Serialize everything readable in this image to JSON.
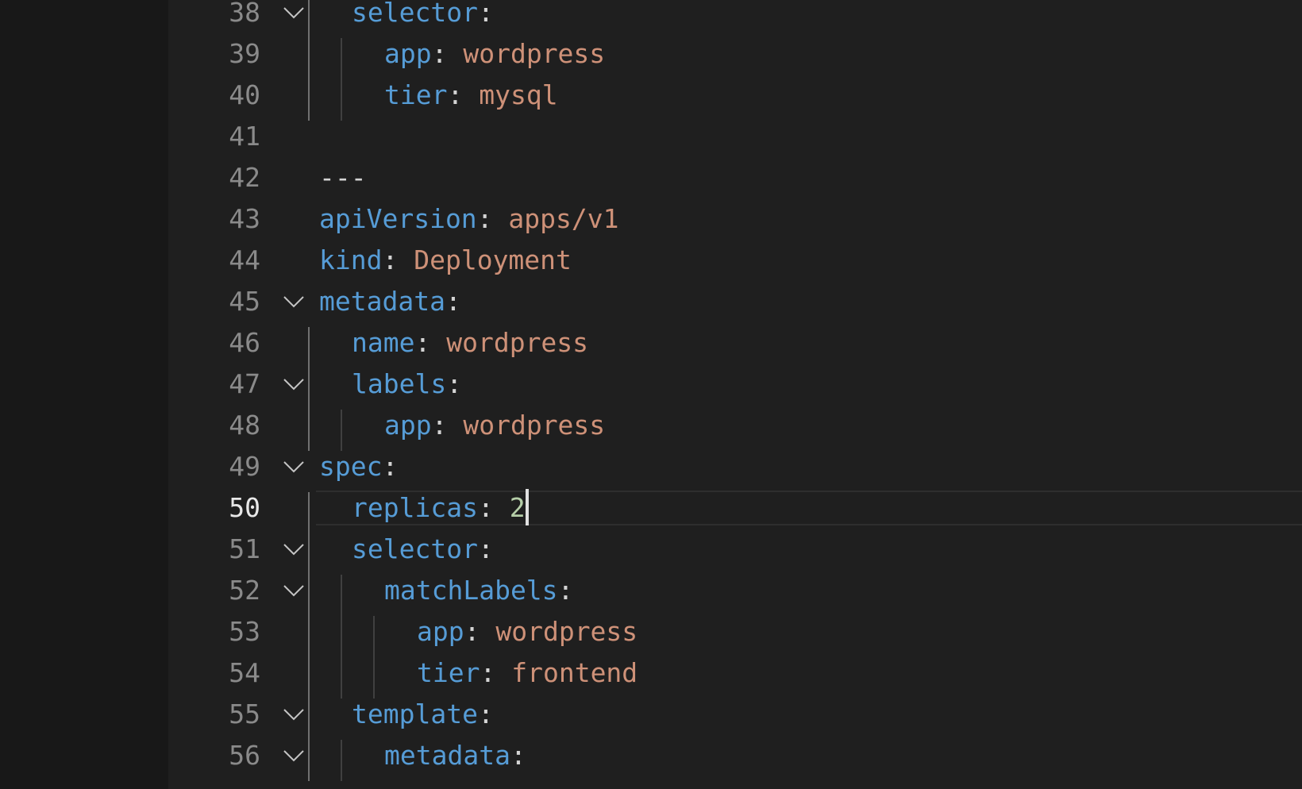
{
  "editor": {
    "lines": [
      {
        "number": "38",
        "indent": 1,
        "fold": true,
        "key": "selector",
        "colon": ":",
        "value": "",
        "vtype": "str"
      },
      {
        "number": "39",
        "indent": 2,
        "fold": false,
        "key": "app",
        "colon": ":",
        "value": " wordpress",
        "vtype": "str"
      },
      {
        "number": "40",
        "indent": 2,
        "fold": false,
        "key": "tier",
        "colon": ":",
        "value": " mysql",
        "vtype": "str"
      },
      {
        "number": "41",
        "indent": 0,
        "fold": false,
        "key": "",
        "colon": "",
        "value": "",
        "vtype": "str"
      },
      {
        "number": "42",
        "indent": 0,
        "fold": false,
        "key": "",
        "colon": "",
        "value": "---",
        "vtype": "sep"
      },
      {
        "number": "43",
        "indent": 0,
        "fold": false,
        "key": "apiVersion",
        "colon": ":",
        "value": " apps/v1",
        "vtype": "str"
      },
      {
        "number": "44",
        "indent": 0,
        "fold": false,
        "key": "kind",
        "colon": ":",
        "value": " Deployment",
        "vtype": "str"
      },
      {
        "number": "45",
        "indent": 0,
        "fold": true,
        "key": "metadata",
        "colon": ":",
        "value": "",
        "vtype": "str"
      },
      {
        "number": "46",
        "indent": 1,
        "fold": false,
        "key": "name",
        "colon": ":",
        "value": " wordpress",
        "vtype": "str"
      },
      {
        "number": "47",
        "indent": 1,
        "fold": true,
        "key": "labels",
        "colon": ":",
        "value": "",
        "vtype": "str"
      },
      {
        "number": "48",
        "indent": 2,
        "fold": false,
        "key": "app",
        "colon": ":",
        "value": " wordpress",
        "vtype": "str"
      },
      {
        "number": "49",
        "indent": 0,
        "fold": true,
        "key": "spec",
        "colon": ":",
        "value": "",
        "vtype": "str"
      },
      {
        "number": "50",
        "indent": 1,
        "fold": false,
        "key": "replicas",
        "colon": ":",
        "value": " 2",
        "vtype": "num",
        "current": true
      },
      {
        "number": "51",
        "indent": 1,
        "fold": true,
        "key": "selector",
        "colon": ":",
        "value": "",
        "vtype": "str"
      },
      {
        "number": "52",
        "indent": 2,
        "fold": true,
        "key": "matchLabels",
        "colon": ":",
        "value": "",
        "vtype": "str"
      },
      {
        "number": "53",
        "indent": 3,
        "fold": false,
        "key": "app",
        "colon": ":",
        "value": " wordpress",
        "vtype": "str"
      },
      {
        "number": "54",
        "indent": 3,
        "fold": false,
        "key": "tier",
        "colon": ":",
        "value": " frontend",
        "vtype": "str"
      },
      {
        "number": "55",
        "indent": 1,
        "fold": true,
        "key": "template",
        "colon": ":",
        "value": "",
        "vtype": "str"
      },
      {
        "number": "56",
        "indent": 2,
        "fold": true,
        "key": "metadata",
        "colon": ":",
        "value": "",
        "vtype": "str"
      }
    ],
    "fold_icon": "chevron-down-icon"
  },
  "colors": {
    "background": "#1f1f1f",
    "key": "#569cd6",
    "string": "#ce9178",
    "number": "#b5cea8",
    "line_number": "#8a8a8a",
    "line_number_current": "#e8e8e8"
  }
}
